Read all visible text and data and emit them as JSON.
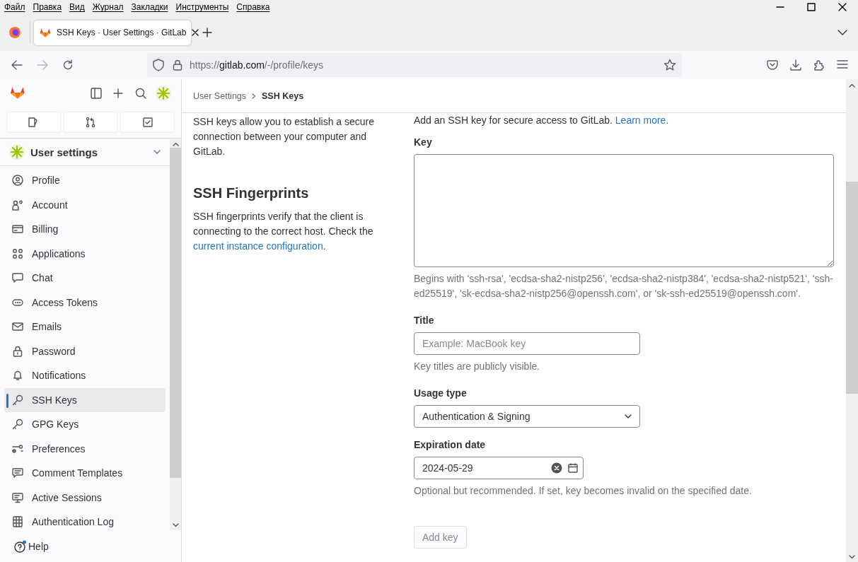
{
  "menu_bar": [
    "Файл",
    "Правка",
    "Вид",
    "Журнал",
    "Закладки",
    "Инструменты",
    "Справка"
  ],
  "browser_tab": {
    "title": "SSH Keys · User Settings · GitLab",
    "selected": true
  },
  "address_bar": {
    "scheme": "https://",
    "host": "gitlab.com",
    "path": "/-/profile/keys"
  },
  "sidebar": {
    "title": "User settings",
    "items": [
      {
        "label": "Profile",
        "selected": false
      },
      {
        "label": "Account",
        "selected": false
      },
      {
        "label": "Billing",
        "selected": false
      },
      {
        "label": "Applications",
        "selected": false
      },
      {
        "label": "Chat",
        "selected": false
      },
      {
        "label": "Access Tokens",
        "selected": false
      },
      {
        "label": "Emails",
        "selected": false
      },
      {
        "label": "Password",
        "selected": false
      },
      {
        "label": "Notifications",
        "selected": false
      },
      {
        "label": "SSH Keys",
        "selected": true
      },
      {
        "label": "GPG Keys",
        "selected": false
      },
      {
        "label": "Preferences",
        "selected": false
      },
      {
        "label": "Comment Templates",
        "selected": false
      },
      {
        "label": "Active Sessions",
        "selected": false
      },
      {
        "label": "Authentication Log",
        "selected": false
      }
    ],
    "help": "Help"
  },
  "breadcrumbs": [
    "User Settings",
    "SSH Keys"
  ],
  "intro": "SSH keys allow you to establish a secure connection between your computer and GitLab.",
  "fingerprints": {
    "heading": "SSH Fingerprints",
    "text": "SSH fingerprints verify that the client is connecting to the correct host. Check the",
    "link": "current instance configuration",
    "after": "."
  },
  "form": {
    "description": "Add an SSH key for secure access to GitLab.",
    "description_link": "Learn more.",
    "key": {
      "label": "Key",
      "help": "Begins with 'ssh-rsa', 'ecdsa-sha2-nistp256', 'ecdsa-sha2-nistp384', 'ecdsa-sha2-nistp521', 'ssh-ed25519', 'sk-ecdsa-sha2-nistp256@openssh.com', or 'sk-ssh-ed25519@openssh.com'."
    },
    "title": {
      "label": "Title",
      "placeholder": "Example: MacBook key",
      "help": "Key titles are publicly visible."
    },
    "usage_type": {
      "label": "Usage type",
      "value": "Authentication & Signing"
    },
    "expiration": {
      "label": "Expiration date",
      "value": "2024-05-29",
      "help": "Optional but recommended. If set, key becomes invalid on the specified date."
    },
    "submit": {
      "label": "Add key",
      "disabled": true
    }
  }
}
